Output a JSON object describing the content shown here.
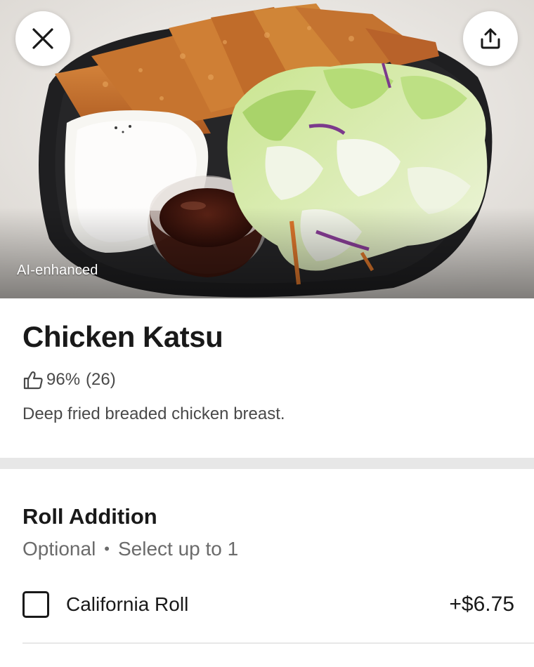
{
  "hero": {
    "badge_text": "AI-enhanced",
    "close_icon": "close-icon",
    "share_icon": "share-icon"
  },
  "item": {
    "name": "Chicken Katsu",
    "rating_icon": "thumbs-up-icon",
    "rating_percent": "96%",
    "rating_count": "(26)",
    "description": "Deep fried breaded chicken breast."
  },
  "option_group": {
    "title": "Roll Addition",
    "requirement": "Optional",
    "separator": "•",
    "limit": "Select up to 1",
    "options": [
      {
        "label": "California Roll",
        "price": "+$6.75",
        "checked": false
      }
    ]
  },
  "colors": {
    "text_primary": "#191919",
    "text_secondary": "#494949",
    "text_muted": "#6b6b6b",
    "divider": "#e7e7e7",
    "background": "#ffffff"
  }
}
